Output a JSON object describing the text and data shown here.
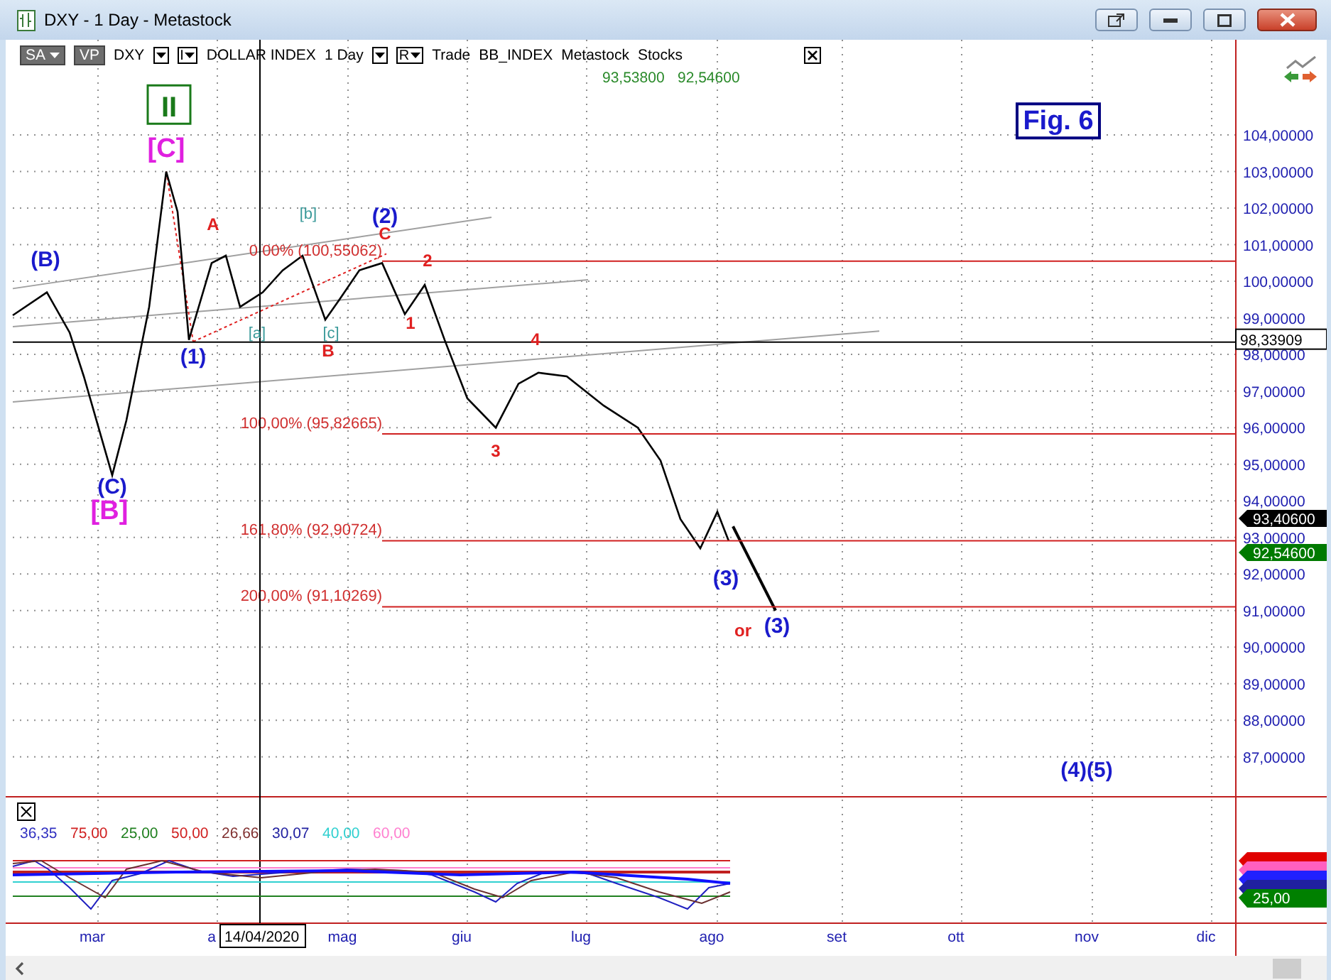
{
  "window": {
    "title": "DXY - 1 Day - Metastock"
  },
  "toolbar": {
    "items": [
      {
        "kind": "dropdown",
        "label": "SA"
      },
      {
        "kind": "toggle",
        "label": "VP"
      },
      {
        "kind": "text",
        "label": "DXY"
      },
      {
        "kind": "caret"
      },
      {
        "kind": "letter_menu",
        "label": "I"
      },
      {
        "kind": "text",
        "label": "DOLLAR INDEX"
      },
      {
        "kind": "text",
        "label": "1 Day"
      },
      {
        "kind": "caret"
      },
      {
        "kind": "letter_menu",
        "label": "R"
      },
      {
        "kind": "text",
        "label": "Trade"
      },
      {
        "kind": "text",
        "label": "BB_INDEX"
      },
      {
        "kind": "text",
        "label": "Metastock"
      },
      {
        "kind": "text",
        "label": "Stocks"
      },
      {
        "kind": "close"
      }
    ]
  },
  "quote_values": [
    "93,53800",
    "92,54600"
  ],
  "price_chart": {
    "figure_label": "Fig. 6",
    "last_price_tags": [
      {
        "text": "93,40600",
        "color": "#000000"
      },
      {
        "text": "92,54600",
        "color": "#007a00"
      }
    ],
    "crosshair": {
      "price_label": "98,33909",
      "date_label": "14/04/2020"
    },
    "fib_levels": [
      {
        "label": "0,00% (100,55062)"
      },
      {
        "label": "100,00% (95,82665)"
      },
      {
        "label": "161,80% (92,90724)"
      },
      {
        "label": "200,00% (91,10269)"
      }
    ],
    "wave_labels": [
      {
        "kind": "boxed",
        "text": "II",
        "color": "#1a7a1a"
      },
      {
        "kind": "major",
        "text": "[C]",
        "color": "#e020e0"
      },
      {
        "kind": "wave",
        "text": "(B)",
        "color": "#1a1acc"
      },
      {
        "kind": "wave",
        "text": "(C)",
        "color": "#1a1acc"
      },
      {
        "kind": "major",
        "text": "[B]",
        "color": "#e020e0"
      },
      {
        "kind": "minor",
        "text": "A",
        "color": "#e02020"
      },
      {
        "kind": "small",
        "text": "[b]",
        "color": "#3a9a9a"
      },
      {
        "kind": "wave",
        "text": "(2)",
        "color": "#1a1acc"
      },
      {
        "kind": "minor",
        "text": "C",
        "color": "#e02020"
      },
      {
        "kind": "minor",
        "text": "2",
        "color": "#e02020"
      },
      {
        "kind": "minor",
        "text": "1",
        "color": "#e02020"
      },
      {
        "kind": "wave",
        "text": "(1)",
        "color": "#1a1acc"
      },
      {
        "kind": "small",
        "text": "[a]",
        "color": "#3a9a9a"
      },
      {
        "kind": "small",
        "text": "[c]",
        "color": "#3a9a9a"
      },
      {
        "kind": "minor",
        "text": "B",
        "color": "#e02020"
      },
      {
        "kind": "minor",
        "text": "4",
        "color": "#e02020"
      },
      {
        "kind": "minor",
        "text": "3",
        "color": "#e02020"
      },
      {
        "kind": "wave",
        "text": "(3)",
        "color": "#1a1acc"
      },
      {
        "kind": "minor",
        "text": "or",
        "color": "#e02020"
      },
      {
        "kind": "wave",
        "text": "(3)",
        "color": "#1a1acc"
      },
      {
        "kind": "wave",
        "text": "(4)(5)",
        "color": "#1a1acc"
      }
    ],
    "month_labels": [
      "mar",
      "a",
      "mag",
      "giu",
      "lug",
      "ago",
      "set",
      "ott",
      "nov",
      "dic"
    ],
    "price_axis_labels": [
      "104,00000",
      "103,00000",
      "102,00000",
      "101,00000",
      "100,00000",
      "99,00000",
      "98,00000",
      "97,00000",
      "96,00000",
      "95,00000",
      "94,00000",
      "93,00000",
      "92,00000",
      "91,00000",
      "90,00000",
      "89,00000",
      "88,00000",
      "87,00000"
    ]
  },
  "indicator": {
    "legend": [
      {
        "text": "36,35",
        "color": "#3030c0"
      },
      {
        "text": "75,00",
        "color": "#d02020"
      },
      {
        "text": "25,00",
        "color": "#208020"
      },
      {
        "text": "50,00",
        "color": "#d02020"
      },
      {
        "text": "26,66",
        "color": "#803030"
      },
      {
        "text": "30,07",
        "color": "#2020a0"
      },
      {
        "text": "40,00",
        "color": "#30d0d0"
      },
      {
        "text": "60,00",
        "color": "#ff80d0"
      }
    ],
    "axis_tags": [
      {
        "color": "#e00000"
      },
      {
        "color": "#ff60c0"
      },
      {
        "color": "#2020ff"
      },
      {
        "color": "#2020a0"
      },
      {
        "color": "#008000",
        "text": "25,00"
      }
    ]
  }
}
